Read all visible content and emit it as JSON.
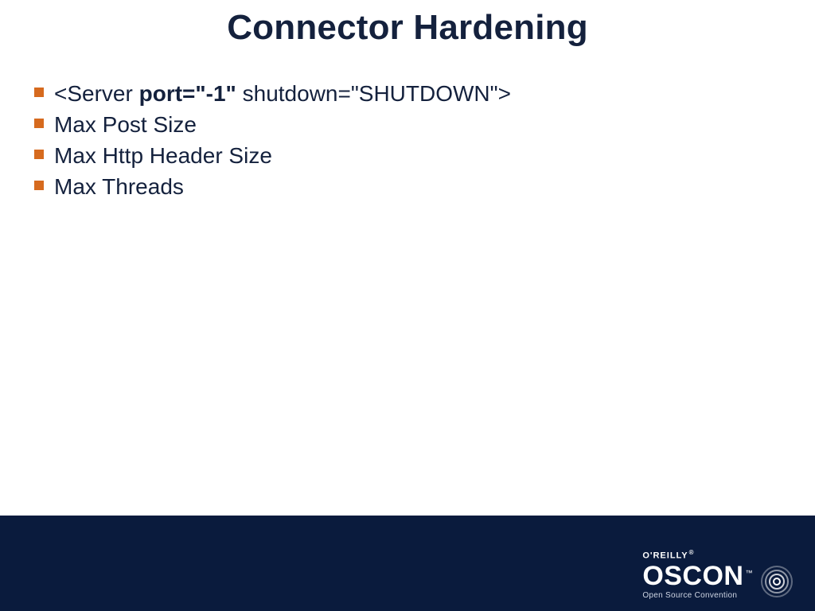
{
  "title": "Connector Hardening",
  "bullets": [
    {
      "prefix": "<Server ",
      "bold": "port=\"-1\"",
      "suffix": " shutdown=\"SHUTDOWN\">"
    },
    {
      "text": "Max Post Size"
    },
    {
      "text": "Max Http Header Size"
    },
    {
      "text": "Max Threads"
    }
  ],
  "footer": {
    "brand_top": "O'REILLY",
    "brand_main": "OSCON",
    "brand_sub": "Open Source Convention"
  },
  "colors": {
    "bullet_square": "#d66a1e",
    "text": "#14213d",
    "footer_bg": "#0a1b3d"
  }
}
